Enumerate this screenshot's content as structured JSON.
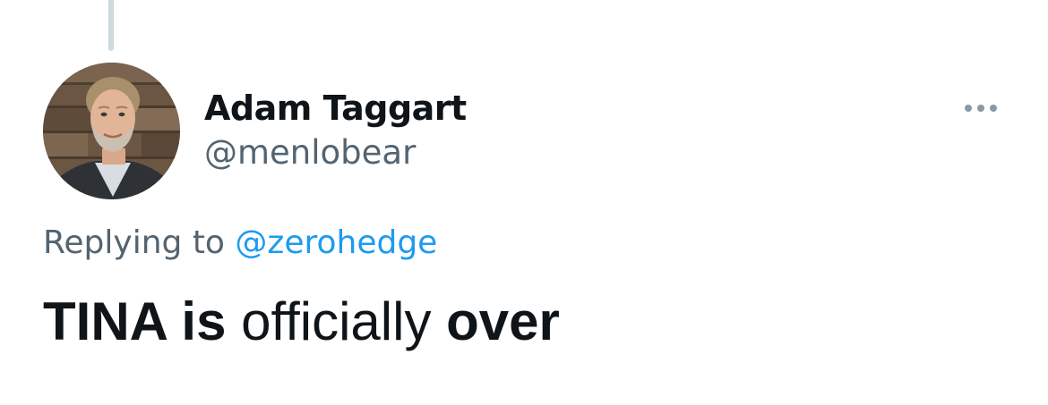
{
  "user": {
    "display_name": "Adam Taggart",
    "handle": "@menlobear"
  },
  "reply": {
    "prefix": "Replying to",
    "mention": "@zerohedge"
  },
  "tweet": {
    "segments": [
      {
        "text": "TINA is",
        "style": "bold"
      },
      {
        "text": " officially ",
        "style": "normal"
      },
      {
        "text": "over",
        "style": "bold"
      }
    ]
  },
  "icons": {
    "more": "more-horizontal-icon"
  },
  "colors": {
    "text_primary": "#0f1419",
    "text_secondary": "#536471",
    "link": "#1d9bf0",
    "thread_line": "#cfd9de"
  }
}
